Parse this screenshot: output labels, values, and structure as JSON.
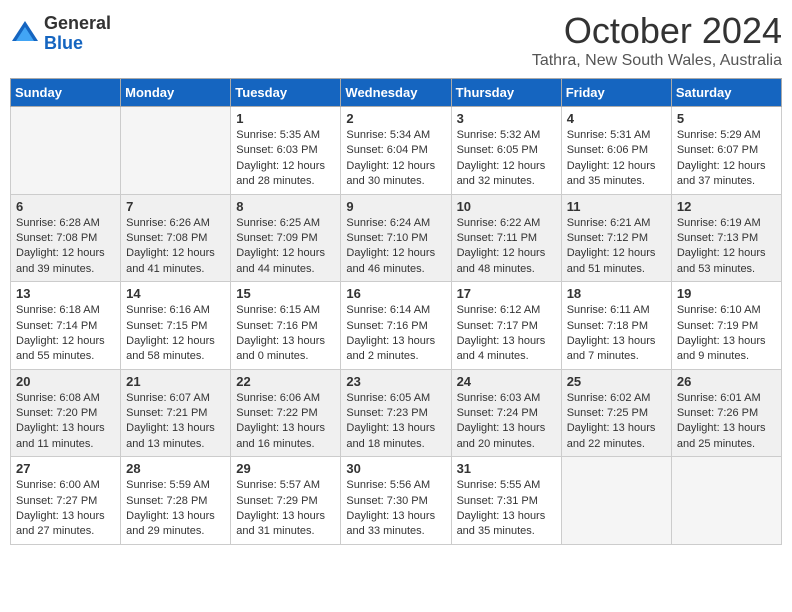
{
  "logo": {
    "general": "General",
    "blue": "Blue"
  },
  "title": "October 2024",
  "location": "Tathra, New South Wales, Australia",
  "days_of_week": [
    "Sunday",
    "Monday",
    "Tuesday",
    "Wednesday",
    "Thursday",
    "Friday",
    "Saturday"
  ],
  "weeks": [
    [
      {
        "day": "",
        "sunrise": "",
        "sunset": "",
        "daylight": ""
      },
      {
        "day": "",
        "sunrise": "",
        "sunset": "",
        "daylight": ""
      },
      {
        "day": "1",
        "sunrise": "Sunrise: 5:35 AM",
        "sunset": "Sunset: 6:03 PM",
        "daylight": "Daylight: 12 hours and 28 minutes."
      },
      {
        "day": "2",
        "sunrise": "Sunrise: 5:34 AM",
        "sunset": "Sunset: 6:04 PM",
        "daylight": "Daylight: 12 hours and 30 minutes."
      },
      {
        "day": "3",
        "sunrise": "Sunrise: 5:32 AM",
        "sunset": "Sunset: 6:05 PM",
        "daylight": "Daylight: 12 hours and 32 minutes."
      },
      {
        "day": "4",
        "sunrise": "Sunrise: 5:31 AM",
        "sunset": "Sunset: 6:06 PM",
        "daylight": "Daylight: 12 hours and 35 minutes."
      },
      {
        "day": "5",
        "sunrise": "Sunrise: 5:29 AM",
        "sunset": "Sunset: 6:07 PM",
        "daylight": "Daylight: 12 hours and 37 minutes."
      }
    ],
    [
      {
        "day": "6",
        "sunrise": "Sunrise: 6:28 AM",
        "sunset": "Sunset: 7:08 PM",
        "daylight": "Daylight: 12 hours and 39 minutes."
      },
      {
        "day": "7",
        "sunrise": "Sunrise: 6:26 AM",
        "sunset": "Sunset: 7:08 PM",
        "daylight": "Daylight: 12 hours and 41 minutes."
      },
      {
        "day": "8",
        "sunrise": "Sunrise: 6:25 AM",
        "sunset": "Sunset: 7:09 PM",
        "daylight": "Daylight: 12 hours and 44 minutes."
      },
      {
        "day": "9",
        "sunrise": "Sunrise: 6:24 AM",
        "sunset": "Sunset: 7:10 PM",
        "daylight": "Daylight: 12 hours and 46 minutes."
      },
      {
        "day": "10",
        "sunrise": "Sunrise: 6:22 AM",
        "sunset": "Sunset: 7:11 PM",
        "daylight": "Daylight: 12 hours and 48 minutes."
      },
      {
        "day": "11",
        "sunrise": "Sunrise: 6:21 AM",
        "sunset": "Sunset: 7:12 PM",
        "daylight": "Daylight: 12 hours and 51 minutes."
      },
      {
        "day": "12",
        "sunrise": "Sunrise: 6:19 AM",
        "sunset": "Sunset: 7:13 PM",
        "daylight": "Daylight: 12 hours and 53 minutes."
      }
    ],
    [
      {
        "day": "13",
        "sunrise": "Sunrise: 6:18 AM",
        "sunset": "Sunset: 7:14 PM",
        "daylight": "Daylight: 12 hours and 55 minutes."
      },
      {
        "day": "14",
        "sunrise": "Sunrise: 6:16 AM",
        "sunset": "Sunset: 7:15 PM",
        "daylight": "Daylight: 12 hours and 58 minutes."
      },
      {
        "day": "15",
        "sunrise": "Sunrise: 6:15 AM",
        "sunset": "Sunset: 7:16 PM",
        "daylight": "Daylight: 13 hours and 0 minutes."
      },
      {
        "day": "16",
        "sunrise": "Sunrise: 6:14 AM",
        "sunset": "Sunset: 7:16 PM",
        "daylight": "Daylight: 13 hours and 2 minutes."
      },
      {
        "day": "17",
        "sunrise": "Sunrise: 6:12 AM",
        "sunset": "Sunset: 7:17 PM",
        "daylight": "Daylight: 13 hours and 4 minutes."
      },
      {
        "day": "18",
        "sunrise": "Sunrise: 6:11 AM",
        "sunset": "Sunset: 7:18 PM",
        "daylight": "Daylight: 13 hours and 7 minutes."
      },
      {
        "day": "19",
        "sunrise": "Sunrise: 6:10 AM",
        "sunset": "Sunset: 7:19 PM",
        "daylight": "Daylight: 13 hours and 9 minutes."
      }
    ],
    [
      {
        "day": "20",
        "sunrise": "Sunrise: 6:08 AM",
        "sunset": "Sunset: 7:20 PM",
        "daylight": "Daylight: 13 hours and 11 minutes."
      },
      {
        "day": "21",
        "sunrise": "Sunrise: 6:07 AM",
        "sunset": "Sunset: 7:21 PM",
        "daylight": "Daylight: 13 hours and 13 minutes."
      },
      {
        "day": "22",
        "sunrise": "Sunrise: 6:06 AM",
        "sunset": "Sunset: 7:22 PM",
        "daylight": "Daylight: 13 hours and 16 minutes."
      },
      {
        "day": "23",
        "sunrise": "Sunrise: 6:05 AM",
        "sunset": "Sunset: 7:23 PM",
        "daylight": "Daylight: 13 hours and 18 minutes."
      },
      {
        "day": "24",
        "sunrise": "Sunrise: 6:03 AM",
        "sunset": "Sunset: 7:24 PM",
        "daylight": "Daylight: 13 hours and 20 minutes."
      },
      {
        "day": "25",
        "sunrise": "Sunrise: 6:02 AM",
        "sunset": "Sunset: 7:25 PM",
        "daylight": "Daylight: 13 hours and 22 minutes."
      },
      {
        "day": "26",
        "sunrise": "Sunrise: 6:01 AM",
        "sunset": "Sunset: 7:26 PM",
        "daylight": "Daylight: 13 hours and 25 minutes."
      }
    ],
    [
      {
        "day": "27",
        "sunrise": "Sunrise: 6:00 AM",
        "sunset": "Sunset: 7:27 PM",
        "daylight": "Daylight: 13 hours and 27 minutes."
      },
      {
        "day": "28",
        "sunrise": "Sunrise: 5:59 AM",
        "sunset": "Sunset: 7:28 PM",
        "daylight": "Daylight: 13 hours and 29 minutes."
      },
      {
        "day": "29",
        "sunrise": "Sunrise: 5:57 AM",
        "sunset": "Sunset: 7:29 PM",
        "daylight": "Daylight: 13 hours and 31 minutes."
      },
      {
        "day": "30",
        "sunrise": "Sunrise: 5:56 AM",
        "sunset": "Sunset: 7:30 PM",
        "daylight": "Daylight: 13 hours and 33 minutes."
      },
      {
        "day": "31",
        "sunrise": "Sunrise: 5:55 AM",
        "sunset": "Sunset: 7:31 PM",
        "daylight": "Daylight: 13 hours and 35 minutes."
      },
      {
        "day": "",
        "sunrise": "",
        "sunset": "",
        "daylight": ""
      },
      {
        "day": "",
        "sunrise": "",
        "sunset": "",
        "daylight": ""
      }
    ]
  ]
}
